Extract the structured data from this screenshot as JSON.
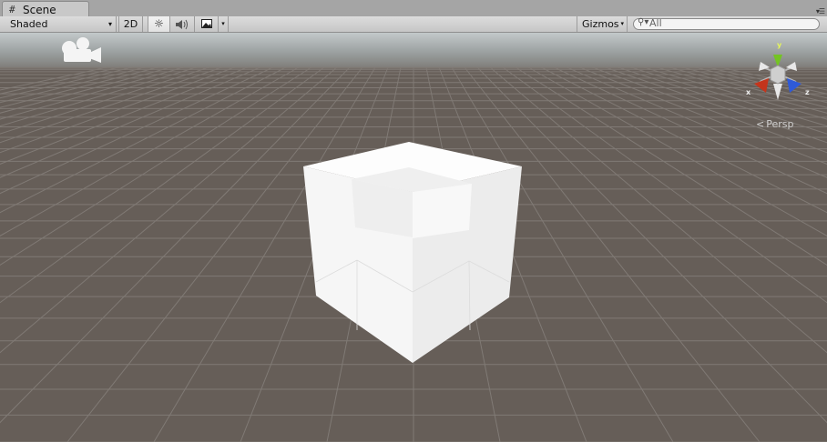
{
  "window": {
    "tab_icon": "grid-icon",
    "tab_label": "Scene",
    "pane_menu_icon": "pane-menu-icon"
  },
  "toolbar": {
    "shading_mode": "Shaded",
    "dropdown_arrow": "▾",
    "mode_2d_label": "2D",
    "lighting_icon": "sun-icon",
    "audio_icon": "speaker-icon",
    "effects_icon": "image-icon",
    "gizmos_label": "Gizmos",
    "search_icon": "search-icon",
    "search_value": "All"
  },
  "scene": {
    "camera_icon": "scene-camera-icon",
    "orientation_gizmo": {
      "axis_x": "x",
      "axis_y": "y",
      "axis_z": "z",
      "colors": {
        "x": "#c4351c",
        "y": "#74c423",
        "z": "#2f5ad8",
        "center": "#cccccc"
      }
    },
    "projection_label": "Persp",
    "projection_symbol": "<",
    "colors": {
      "sky": "#b8bebf",
      "ground": "#655d57",
      "grid": "#7d7873",
      "cube_face": "#f3f3f3"
    }
  }
}
